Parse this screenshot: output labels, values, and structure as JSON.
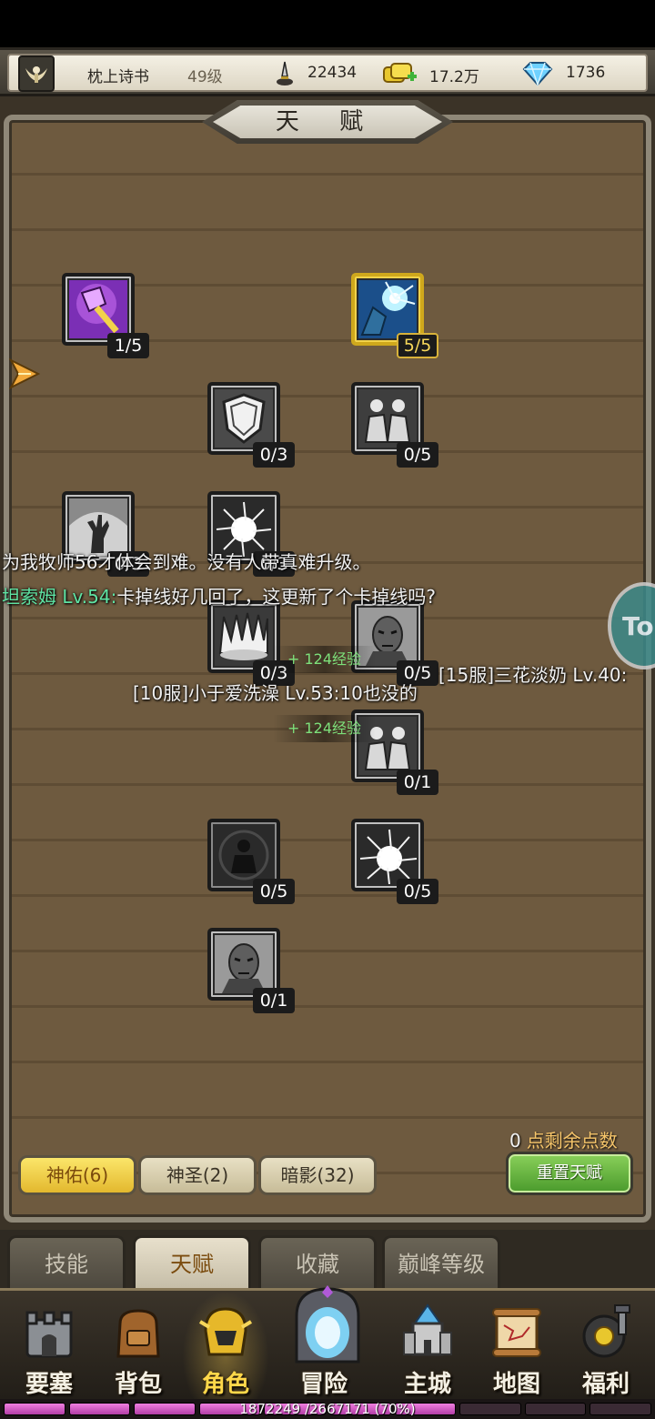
{
  "player": {
    "name": "枕上诗书",
    "level": "49级",
    "currency_a": "22434",
    "gold": "17.2万",
    "diamonds": "1736"
  },
  "panel": {
    "title": "天 赋"
  },
  "talents": [
    {
      "count": "1/5",
      "state": "active"
    },
    {
      "count": "5/5",
      "state": "max"
    },
    {
      "count": "0/3",
      "state": "locked"
    },
    {
      "count": "0/5",
      "state": "locked"
    },
    {
      "count": "0/3",
      "state": "locked"
    },
    {
      "count": "0/3",
      "state": "locked"
    },
    {
      "count": "0/3",
      "state": "locked"
    },
    {
      "count": "0/5",
      "state": "locked"
    },
    {
      "count": "0/1",
      "state": "locked"
    },
    {
      "count": "0/5",
      "state": "locked"
    },
    {
      "count": "0/5",
      "state": "locked"
    },
    {
      "count": "0/1",
      "state": "locked"
    }
  ],
  "chat": {
    "line1": "为我牧师56才体会到难。没有人带真难升级。",
    "line2_name": "坦索姆 Lv.54:",
    "line2_text": "卡掉线好几回了，这更新了个卡掉线吗?",
    "line3": "[15服]三花淡奶 Lv.40:",
    "line4": "[10服]小于爱洗澡 Lv.53:10也没的",
    "exp1": "+ 124经验",
    "exp2": "+ 124经验"
  },
  "side_bubble": "To",
  "points": {
    "value": "0",
    "label": "点剩余点数"
  },
  "branches": [
    {
      "label": "神佑(6)",
      "selected": true
    },
    {
      "label": "神圣(2)",
      "selected": false
    },
    {
      "label": "暗影(32)",
      "selected": false
    }
  ],
  "reset_label": "重置天赋",
  "subtabs": [
    {
      "label": "技能"
    },
    {
      "label": "天赋"
    },
    {
      "label": "收藏"
    },
    {
      "label": "巅峰等级"
    }
  ],
  "nav": [
    {
      "label": "要塞",
      "icon": "fortress-icon"
    },
    {
      "label": "背包",
      "icon": "backpack-icon"
    },
    {
      "label": "角色",
      "icon": "helmet-icon"
    },
    {
      "label": "冒险",
      "icon": "portal-icon"
    },
    {
      "label": "主城",
      "icon": "castle-icon"
    },
    {
      "label": "地图",
      "icon": "scroll-map-icon"
    },
    {
      "label": "福利",
      "icon": "gift-icon"
    }
  ],
  "exp": {
    "text": "1872249 /2667171 (70%)",
    "fraction": 0.7
  },
  "colors": {
    "accent_gold": "#f6d75a",
    "chat_name": "#5fe3a3",
    "exp_fill": "#d45cc8"
  }
}
